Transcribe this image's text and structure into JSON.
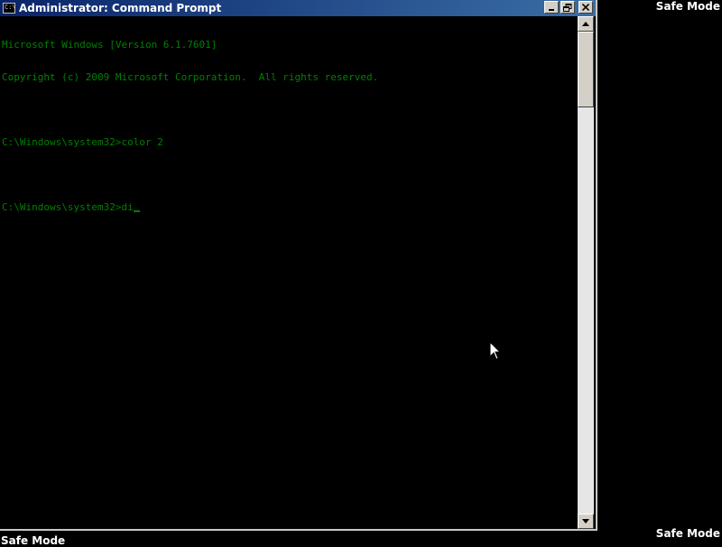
{
  "desktop": {
    "safe_mode_label": "Safe Mode"
  },
  "window": {
    "title": "Administrator: Command Prompt",
    "icon_text": "C:\\"
  },
  "console": {
    "lines": [
      "Microsoft Windows [Version 6.1.7601]",
      "Copyright (c) 2009 Microsoft Corporation.  All rights reserved.",
      "",
      "C:\\Windows\\system32>color 2",
      "",
      "C:\\Windows\\system32>di"
    ],
    "text_color": "#008000",
    "background_color": "#000000"
  }
}
